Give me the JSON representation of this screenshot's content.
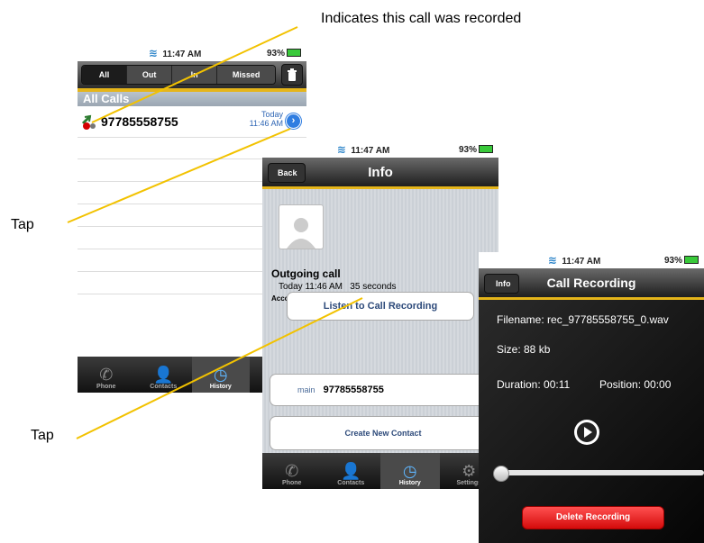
{
  "callouts": {
    "recorded": "Indicates this call was recorded",
    "tap1": "Tap",
    "tap2": "Tap"
  },
  "status": {
    "time": "11:47 AM",
    "battery": "93%"
  },
  "history": {
    "segments": [
      "All",
      "Out",
      "In",
      "Missed"
    ],
    "section": "All Calls",
    "entry": {
      "number": "97785558755",
      "date": "Today",
      "time": "11:46 AM"
    }
  },
  "tabs": [
    "Phone",
    "Contacts",
    "History",
    "Settings"
  ],
  "info": {
    "back": "Back",
    "title": "Info",
    "call_type": "Outgoing call",
    "call_detail": "Today 11:46 AM   35 seconds",
    "account": "Account:",
    "listen": "Listen to Call Recording",
    "line_label": "main",
    "line_number": "97785558755",
    "create": "Create New Contact"
  },
  "recording": {
    "back": "Info",
    "title": "Call Recording",
    "filename": "Filename: rec_97785558755_0.wav",
    "size": "Size: 88 kb",
    "duration": "Duration: 00:11",
    "position": "Position: 00:00",
    "delete": "Delete Recording",
    "progress": 0
  },
  "colors": {
    "accent": "#e5b51a",
    "line": "#f2c200",
    "delete": "#e01818"
  }
}
